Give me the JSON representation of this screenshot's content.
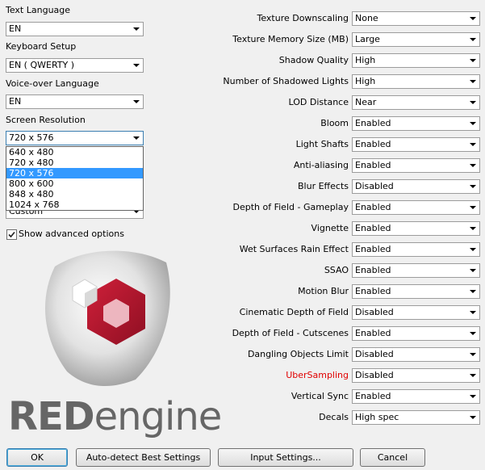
{
  "left": {
    "text_language": {
      "label": "Text Language",
      "value": "EN"
    },
    "keyboard_setup": {
      "label": "Keyboard Setup",
      "value": "EN ( QWERTY )"
    },
    "voiceover_language": {
      "label": "Voice-over Language",
      "value": "EN"
    },
    "screen_resolution": {
      "label": "Screen Resolution",
      "value": "720 x 576",
      "options": [
        "640 x 480",
        "720 x 480",
        "720 x 576",
        "800 x 600",
        "848 x 480",
        "1024 x 768"
      ],
      "selected_index": 2
    },
    "hidden_combo_value": "Custom",
    "show_advanced": {
      "label": "Show advanced options",
      "checked": true
    }
  },
  "logo": {
    "text_bold": "RED",
    "text_light": "engine"
  },
  "settings": [
    {
      "label": "Texture Downscaling",
      "value": "None"
    },
    {
      "label": "Texture Memory Size (MB)",
      "value": "Large"
    },
    {
      "label": "Shadow Quality",
      "value": "High"
    },
    {
      "label": "Number of Shadowed Lights",
      "value": "High"
    },
    {
      "label": "LOD Distance",
      "value": "Near"
    },
    {
      "label": "Bloom",
      "value": "Enabled"
    },
    {
      "label": "Light Shafts",
      "value": "Enabled"
    },
    {
      "label": "Anti-aliasing",
      "value": "Enabled"
    },
    {
      "label": "Blur Effects",
      "value": "Disabled"
    },
    {
      "label": "Depth of Field - Gameplay",
      "value": "Enabled"
    },
    {
      "label": "Vignette",
      "value": "Enabled"
    },
    {
      "label": "Wet Surfaces Rain Effect",
      "value": "Enabled"
    },
    {
      "label": "SSAO",
      "value": "Enabled"
    },
    {
      "label": "Motion Blur",
      "value": "Enabled"
    },
    {
      "label": "Cinematic Depth of Field",
      "value": "Disabled"
    },
    {
      "label": "Depth of Field - Cutscenes",
      "value": "Enabled"
    },
    {
      "label": "Dangling Objects Limit",
      "value": "Disabled"
    },
    {
      "label": "UberSampling",
      "value": "Disabled",
      "highlight": "#e00000"
    },
    {
      "label": "Vertical Sync",
      "value": "Enabled"
    },
    {
      "label": "Decals",
      "value": "High spec"
    }
  ],
  "buttons": {
    "ok": "OK",
    "autodetect": "Auto-detect Best Settings",
    "input_settings": "Input Settings...",
    "cancel": "Cancel"
  }
}
